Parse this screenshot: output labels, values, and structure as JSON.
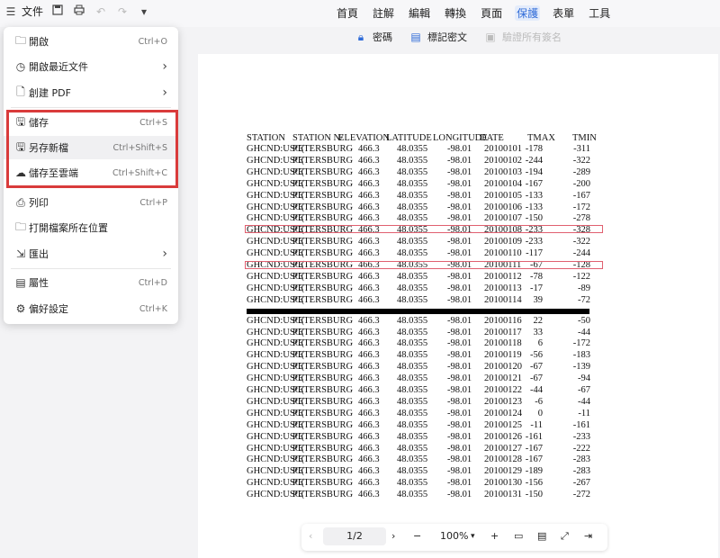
{
  "toolbar": {
    "file_label": "文件",
    "tabs": [
      "首頁",
      "註解",
      "編輯",
      "轉換",
      "頁面",
      "保護",
      "表單",
      "工具"
    ],
    "active_tab": "保護"
  },
  "protect_toolbar": {
    "password": "密碼",
    "mark_redact": "標記密文",
    "verify_signatures": "驗證所有簽名"
  },
  "file_menu": {
    "items": [
      {
        "label": "開啟",
        "shortcut": "Ctrl+O",
        "icon": "folder-open-icon"
      },
      {
        "label": "開啟最近文件",
        "shortcut": "",
        "icon": "clock-icon",
        "submenu": true
      },
      {
        "label": "創建 PDF",
        "shortcut": "",
        "icon": "create-pdf-icon",
        "submenu": true
      },
      {
        "label": "儲存",
        "shortcut": "Ctrl+S",
        "icon": "save-icon"
      },
      {
        "label": "另存新檔",
        "shortcut": "Ctrl+Shift+S",
        "icon": "save-as-icon"
      },
      {
        "label": "儲存至雲端",
        "shortcut": "Ctrl+Shift+C",
        "icon": "cloud-upload-icon"
      },
      {
        "label": "列印",
        "shortcut": "Ctrl+P",
        "icon": "print-icon"
      },
      {
        "label": "打開檔案所在位置",
        "shortcut": "",
        "icon": "folder-location-icon"
      },
      {
        "label": "匯出",
        "shortcut": "",
        "icon": "export-icon",
        "submenu": true
      },
      {
        "label": "屬性",
        "shortcut": "Ctrl+D",
        "icon": "properties-icon"
      },
      {
        "label": "偏好設定",
        "shortcut": "Ctrl+K",
        "icon": "settings-icon"
      }
    ]
  },
  "document": {
    "headers": [
      "STATION",
      "STATION N/",
      "ELEVATION",
      "LATITUDE",
      "LONGITUDE",
      "DATE",
      "TMAX",
      "TMIN"
    ],
    "station": "GHCND:USC(",
    "station_name": "PETERSBURG",
    "elevation": "466.3",
    "latitude": "48.0355",
    "longitude": "-98.01",
    "rows": [
      [
        "20100101",
        "-178",
        "-311"
      ],
      [
        "20100102",
        "-244",
        "-322"
      ],
      [
        "20100103",
        "-194",
        "-289"
      ],
      [
        "20100104",
        "-167",
        "-200"
      ],
      [
        "20100105",
        "-133",
        "-167"
      ],
      [
        "20100106",
        "-133",
        "-172"
      ],
      [
        "20100107",
        "-150",
        "-278"
      ],
      [
        "20100108",
        "-233",
        "-328"
      ],
      [
        "20100109",
        "-233",
        "-322"
      ],
      [
        "20100110",
        "-117",
        "-244"
      ],
      [
        "20100111",
        "-67",
        "-128"
      ],
      [
        "20100112",
        "-78",
        "-122"
      ],
      [
        "20100113",
        "-17",
        "-89"
      ],
      [
        "20100114",
        "39",
        "-72"
      ],
      [
        "20100116",
        "22",
        "-50"
      ],
      [
        "20100117",
        "33",
        "-44"
      ],
      [
        "20100118",
        "6",
        "-172"
      ],
      [
        "20100119",
        "-56",
        "-183"
      ],
      [
        "20100120",
        "-67",
        "-139"
      ],
      [
        "20100121",
        "-67",
        "-94"
      ],
      [
        "20100122",
        "-44",
        "-67"
      ],
      [
        "20100123",
        "-6",
        "-44"
      ],
      [
        "20100124",
        "0",
        "-11"
      ],
      [
        "20100125",
        "-11",
        "-161"
      ],
      [
        "20100126",
        "-161",
        "-233"
      ],
      [
        "20100127",
        "-167",
        "-222"
      ],
      [
        "20100128",
        "-167",
        "-283"
      ],
      [
        "20100129",
        "-189",
        "-283"
      ],
      [
        "20100130",
        "-156",
        "-267"
      ],
      [
        "20100131",
        "-150",
        "-272"
      ]
    ]
  },
  "bottom": {
    "page": "1/2",
    "zoom": "100%"
  }
}
